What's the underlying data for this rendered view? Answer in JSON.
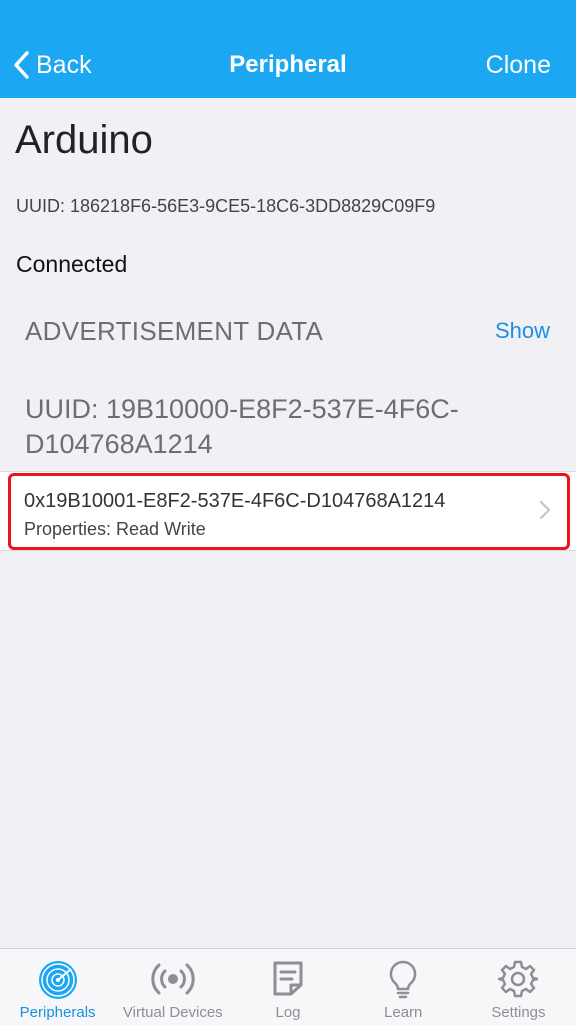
{
  "navbar": {
    "back_label": "Back",
    "title": "Peripheral",
    "clone_label": "Clone"
  },
  "device": {
    "name": "Arduino",
    "uuid": "UUID: 186218F6-56E3-9CE5-18C6-3DD8829C09F9",
    "status": "Connected"
  },
  "advertisement": {
    "header": "ADVERTISEMENT DATA",
    "show_label": "Show"
  },
  "service": {
    "uuid": "UUID: 19B10000-E8F2-537E-4F6C-D104768A1214"
  },
  "characteristic": {
    "uuid": "0x19B10001-E8F2-537E-4F6C-D104768A1214",
    "properties": "Properties: Read Write"
  },
  "tabs": [
    {
      "label": "Peripherals",
      "icon": "radar-icon",
      "active": true
    },
    {
      "label": "Virtual Devices",
      "icon": "broadcast-icon",
      "active": false
    },
    {
      "label": "Log",
      "icon": "log-icon",
      "active": false
    },
    {
      "label": "Learn",
      "icon": "lightbulb-icon",
      "active": false
    },
    {
      "label": "Settings",
      "icon": "gear-icon",
      "active": false
    }
  ],
  "colors": {
    "accent": "#1ba7f2",
    "highlight": "#e8141c",
    "link": "#1b8fe0"
  }
}
